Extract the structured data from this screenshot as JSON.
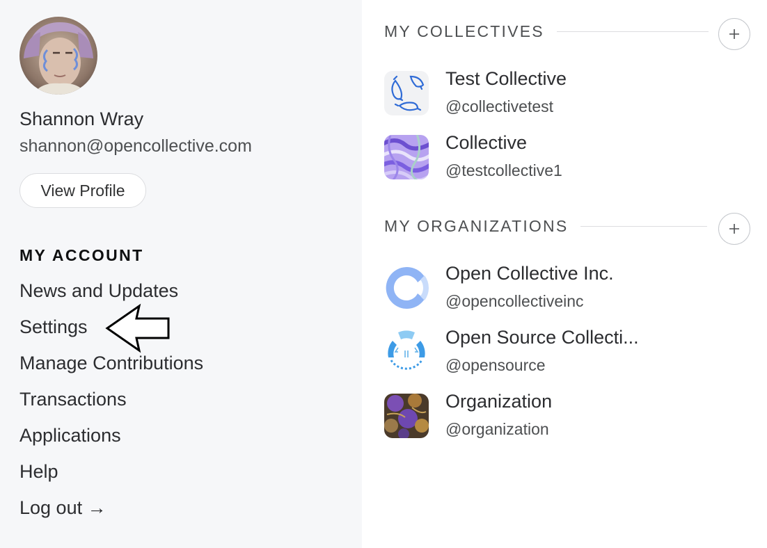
{
  "user": {
    "name": "Shannon Wray",
    "email": "shannon@opencollective.com",
    "view_profile_label": "View Profile"
  },
  "account": {
    "title": "MY ACCOUNT",
    "items": [
      {
        "label": "News and Updates"
      },
      {
        "label": "Settings"
      },
      {
        "label": "Manage Contributions"
      },
      {
        "label": "Transactions"
      },
      {
        "label": "Applications"
      },
      {
        "label": "Help"
      },
      {
        "label": "Log out →"
      }
    ]
  },
  "collectives": {
    "title": "MY COLLECTIVES",
    "add_icon": "plus-icon",
    "items": [
      {
        "name": "Test Collective",
        "slug": "@collectivetest"
      },
      {
        "name": "Collective",
        "slug": "@testcollective1"
      }
    ]
  },
  "organizations": {
    "title": "MY ORGANIZATIONS",
    "add_icon": "plus-icon",
    "items": [
      {
        "name": "Open Collective Inc.",
        "slug": "@opencollectiveinc"
      },
      {
        "name": "Open Source Collecti...",
        "slug": "@opensource"
      },
      {
        "name": "Organization",
        "slug": "@organization"
      }
    ]
  },
  "annotation": {
    "icon": "pointer-arrow-icon"
  },
  "colors": {
    "left_panel_bg": "#f6f7f9",
    "text_primary": "#2c2d30",
    "text_secondary": "#4d4f51",
    "oc_blue": "#8fb4f5",
    "border": "#dcdde0"
  }
}
